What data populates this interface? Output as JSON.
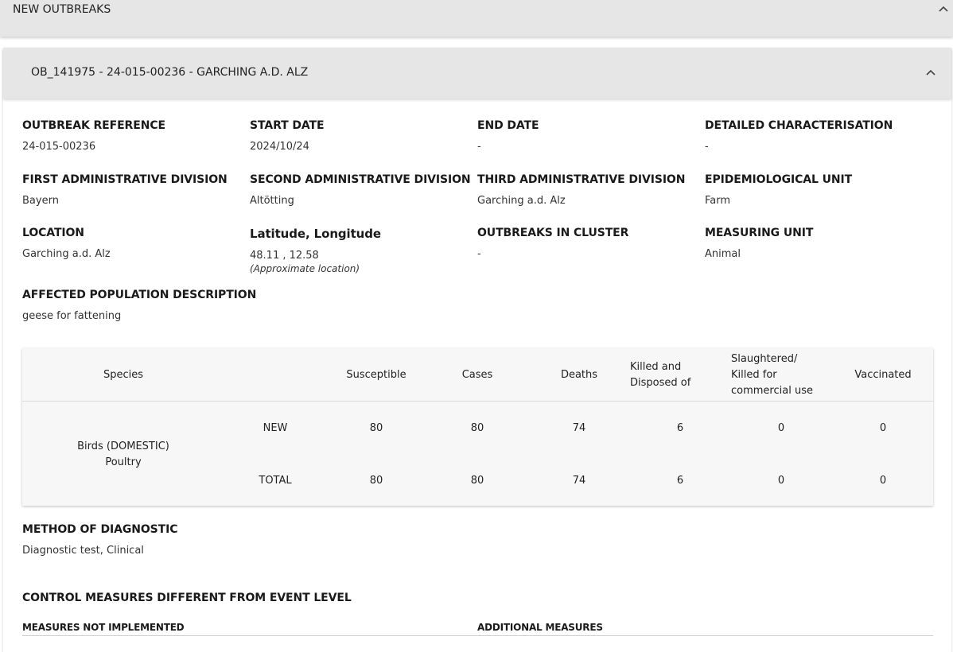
{
  "top_section": {
    "title": "NEW OUTBREAKS"
  },
  "outbreak": {
    "header_title": "OB_141975 - 24-015-00236 - GARCHING A.D. ALZ",
    "fields": {
      "outbreak_reference": {
        "label": "OUTBREAK REFERENCE",
        "value": "24-015-00236"
      },
      "start_date": {
        "label": "START DATE",
        "value": "2024/10/24"
      },
      "end_date": {
        "label": "END DATE",
        "value": "-"
      },
      "detailed_characterisation": {
        "label": "DETAILED CHARACTERISATION",
        "value": "-"
      },
      "first_admin_division": {
        "label": "FIRST ADMINISTRATIVE DIVISION",
        "value": "Bayern"
      },
      "second_admin_division": {
        "label": "SECOND ADMINISTRATIVE DIVISION",
        "value": "Altötting"
      },
      "third_admin_division": {
        "label": "THIRD ADMINISTRATIVE DIVISION",
        "value": "Garching a.d. Alz"
      },
      "epidemiological_unit": {
        "label": "EPIDEMIOLOGICAL UNIT",
        "value": "Farm"
      },
      "location": {
        "label": "LOCATION",
        "value": "Garching a.d. Alz"
      },
      "lat_long": {
        "label": "Latitude, Longitude",
        "value": "48.11 , 12.58",
        "note": "(Approximate location)"
      },
      "outbreaks_in_cluster": {
        "label": "OUTBREAKS IN CLUSTER",
        "value": "-"
      },
      "measuring_unit": {
        "label": "MEASURING UNIT",
        "value": "Animal"
      },
      "affected_population": {
        "label": "AFFECTED POPULATION DESCRIPTION",
        "value": "geese for fattening"
      }
    },
    "species_table": {
      "headers": {
        "species": "Species",
        "susceptible": "Susceptible",
        "cases": "Cases",
        "deaths": "Deaths",
        "killed_disposed": "Killed and\nDisposed of",
        "slaughtered": "Slaughtered/\nKilled for\ncommercial use",
        "vaccinated": "Vaccinated"
      },
      "species_name": "Birds (DOMESTIC)\nPoultry",
      "rows": [
        {
          "type": "NEW",
          "susceptible": "80",
          "cases": "80",
          "deaths": "74",
          "killed_disposed": "6",
          "slaughtered": "0",
          "vaccinated": "0"
        },
        {
          "type": "TOTAL",
          "susceptible": "80",
          "cases": "80",
          "deaths": "74",
          "killed_disposed": "6",
          "slaughtered": "0",
          "vaccinated": "0"
        }
      ]
    },
    "method_of_diagnostic": {
      "label": "METHOD OF DIAGNOSTIC",
      "value": "Diagnostic test, Clinical"
    },
    "control_measures": {
      "title": "CONTROL MEASURES DIFFERENT FROM EVENT LEVEL",
      "not_implemented_label": "MEASURES NOT IMPLEMENTED",
      "additional_label": "ADDITIONAL MEASURES"
    }
  }
}
